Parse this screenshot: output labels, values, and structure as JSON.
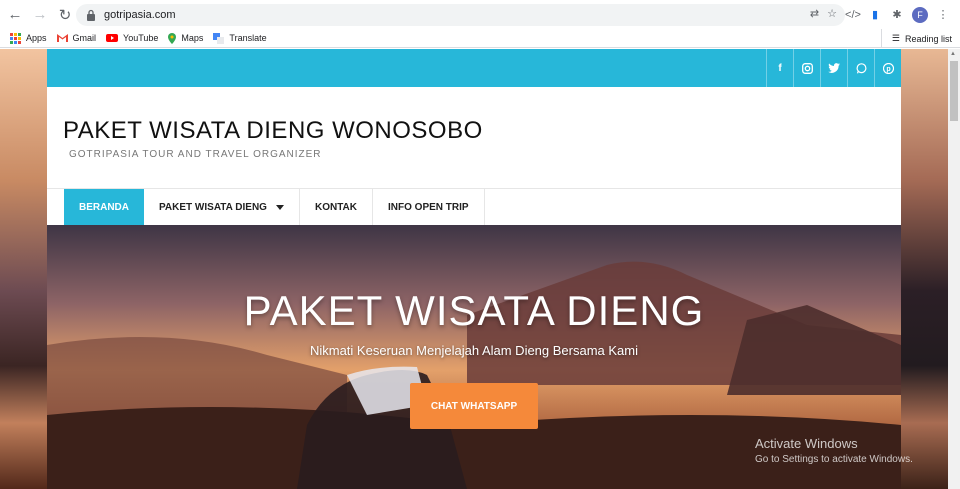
{
  "browser": {
    "url": "gotripasia.com",
    "profile_initial": "F",
    "bookmarks": [
      {
        "label": "Apps",
        "icon": "apps-grid-icon"
      },
      {
        "label": "Gmail",
        "icon": "gmail-icon"
      },
      {
        "label": "YouTube",
        "icon": "youtube-icon"
      },
      {
        "label": "Maps",
        "icon": "maps-icon"
      },
      {
        "label": "Translate",
        "icon": "translate-icon"
      }
    ],
    "reading_list": "Reading list"
  },
  "site": {
    "title": "PAKET WISATA DIENG WONOSOBO",
    "tagline": "GOTRIPASIA TOUR AND TRAVEL ORGANIZER",
    "accent_color": "#27b7d9",
    "social": [
      "facebook-icon",
      "instagram-icon",
      "twitter-icon",
      "whatsapp-icon",
      "pinterest-icon"
    ],
    "menu": [
      {
        "label": "BERANDA",
        "active": true
      },
      {
        "label": "PAKET WISATA DIENG",
        "has_dropdown": true
      },
      {
        "label": "KONTAK"
      },
      {
        "label": "INFO OPEN TRIP"
      }
    ]
  },
  "hero": {
    "title": "PAKET WISATA DIENG",
    "subtitle": "Nikmati Keseruan Menjelajah Alam Dieng Bersama Kami",
    "button_label": "CHAT WHATSAPP",
    "button_color": "#f5893a"
  },
  "watermark": {
    "line1": "Activate Windows",
    "line2": "Go to Settings to activate Windows."
  }
}
